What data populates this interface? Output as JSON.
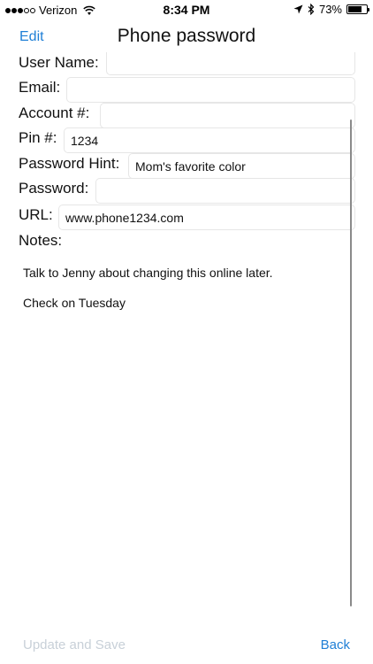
{
  "status_bar": {
    "carrier": "Verizon",
    "signal_bars_filled": 3,
    "signal_bars_total": 5,
    "time": "8:34 PM",
    "battery_percent": "73%",
    "battery_level": 0.73,
    "icons": [
      "wifi-icon",
      "location-arrow-icon",
      "bluetooth-icon",
      "battery-icon"
    ]
  },
  "nav": {
    "edit_label": "Edit",
    "title": "Phone password"
  },
  "form": {
    "fields": [
      {
        "label": "User Name:",
        "value": ""
      },
      {
        "label": "Email:",
        "value": ""
      },
      {
        "label": "Account #:",
        "value": ""
      },
      {
        "label": "Pin #:",
        "value": "1234"
      },
      {
        "label": "Password Hint:",
        "value": "Mom's favorite color"
      },
      {
        "label": "Password:",
        "value": ""
      },
      {
        "label": "URL:",
        "value": "www.phone1234.com"
      }
    ],
    "notes_label": "Notes:",
    "notes_lines": [
      "Talk to Jenny about changing this online later.",
      "Check on Tuesday"
    ]
  },
  "bottom": {
    "update_label": "Update and Save",
    "back_label": "Back"
  },
  "colors": {
    "accent": "#1f7fd6",
    "disabled": "#c8d0d8"
  }
}
